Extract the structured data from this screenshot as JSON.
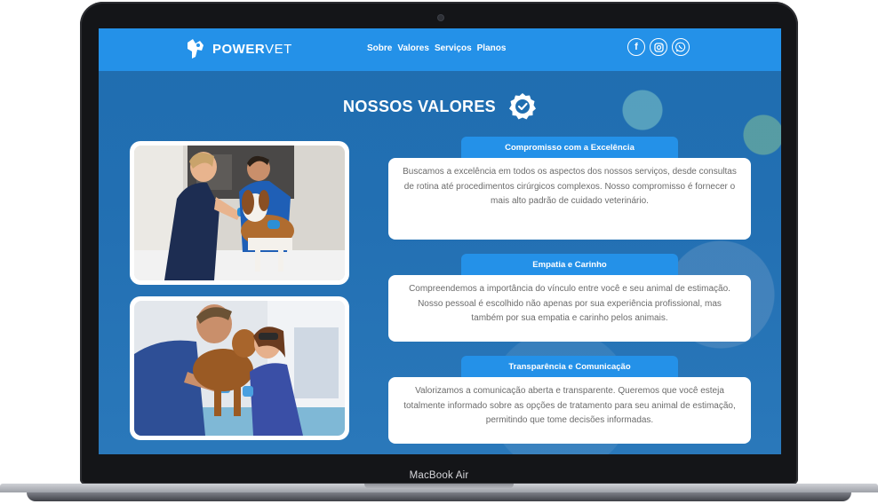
{
  "brand": {
    "name_bold": "POWER",
    "name_light": "VET"
  },
  "nav": {
    "items": [
      "Sobre",
      "Valores",
      "Serviços",
      "Planos"
    ]
  },
  "social": {
    "facebook": "f"
  },
  "section": {
    "title": "NOSSOS VALORES"
  },
  "values": [
    {
      "title": "Compromisso com a Excelência",
      "text": "Buscamos a excelência em todos os aspectos dos nossos serviços, desde consultas de rotina até procedimentos cirúrgicos complexos. Nosso compromisso é fornecer o mais alto padrão de cuidado veterinário."
    },
    {
      "title": "Empatia e Carinho",
      "text": "Compreendemos a importância do vínculo entre você e seu animal de estimação. Nosso pessoal é escolhido não apenas por sua experiência profissional, mas também por sua empatia e carinho pelos animais."
    },
    {
      "title": "Transparência e Comunicação",
      "text": "Valorizamos a comunicação aberta e transparente. Queremos que você esteja totalmente informado sobre as opções de tratamento para seu animal de estimação, permitindo que tome decisões informadas."
    }
  ],
  "device": {
    "label": "MacBook Air"
  },
  "colors": {
    "primary": "#2491e8",
    "background": "#1f6eb0",
    "card": "#ffffff"
  },
  "icons": [
    "powervet-logo-icon",
    "facebook-icon",
    "instagram-icon",
    "whatsapp-icon",
    "verified-badge-icon"
  ]
}
